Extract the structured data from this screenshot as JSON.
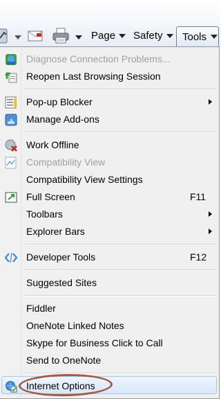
{
  "toolbar": {
    "page_label": "Page",
    "safety_label": "Safety",
    "tools_label": "Tools"
  },
  "menu": {
    "items": [
      {
        "label": "Diagnose Connection Problems...",
        "enabled": false,
        "icon": "globe-network-icon"
      },
      {
        "label": "Reopen Last Browsing Session",
        "enabled": true,
        "icon": "reopen-session-icon"
      },
      {
        "label": "Pop-up Blocker",
        "enabled": true,
        "icon": "popup-blocker-icon",
        "submenu": true
      },
      {
        "label": "Manage Add-ons",
        "enabled": true,
        "icon": "puzzle-addons-icon"
      },
      {
        "label": "Work Offline",
        "enabled": true,
        "icon": "offline-globe-icon"
      },
      {
        "label": "Compatibility View",
        "enabled": false,
        "icon": "compatibility-view-icon"
      },
      {
        "label": "Compatibility View Settings",
        "enabled": true
      },
      {
        "label": "Full Screen",
        "enabled": true,
        "icon": "fullscreen-icon",
        "shortcut": "F11"
      },
      {
        "label": "Toolbars",
        "enabled": true,
        "submenu": true
      },
      {
        "label": "Explorer Bars",
        "enabled": true,
        "submenu": true
      },
      {
        "label": "Developer Tools",
        "enabled": true,
        "icon": "developer-tools-icon",
        "shortcut": "F12"
      },
      {
        "label": "Suggested Sites",
        "enabled": true
      },
      {
        "label": "Fiddler",
        "enabled": true
      },
      {
        "label": "OneNote Linked Notes",
        "enabled": true
      },
      {
        "label": "Skype for Business Click to Call",
        "enabled": true
      },
      {
        "label": "Send to OneNote",
        "enabled": true
      },
      {
        "label": "Internet Options",
        "enabled": true,
        "icon": "internet-options-icon",
        "highlighted": true
      }
    ]
  },
  "colors": {
    "highlight": "#d8e7fa",
    "annotation_circle": "#a55a45",
    "disabled_text": "#a0a0a0"
  }
}
